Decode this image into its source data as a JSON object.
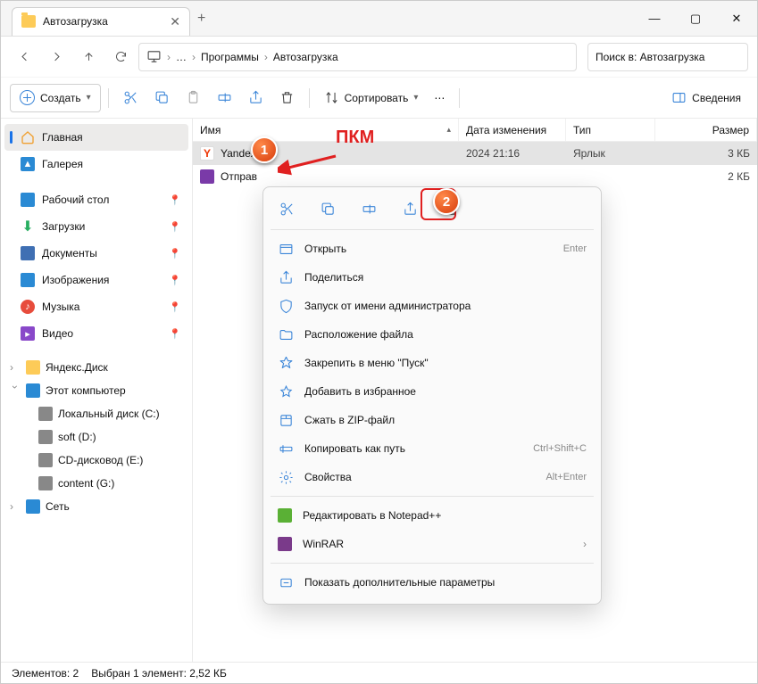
{
  "window": {
    "tab_title": "Автозагрузка"
  },
  "nav": {
    "crumbs": {
      "root_icon": "monitor",
      "ellipsis": "…",
      "item1": "Программы",
      "item2": "Автозагрузка"
    },
    "search_placeholder": "Поиск в: Автозагрузка"
  },
  "toolbar": {
    "create": "Создать",
    "sort": "Сортировать",
    "details": "Сведения"
  },
  "sidebar": {
    "home": "Главная",
    "gallery": "Галерея",
    "desktop": "Рабочий стол",
    "downloads": "Загрузки",
    "documents": "Документы",
    "pictures": "Изображения",
    "music": "Музыка",
    "video": "Видео",
    "yadisk": "Яндекс.Диск",
    "thispc": "Этот компьютер",
    "drive_c": "Локальный диск (C:)",
    "drive_d": "soft (D:)",
    "drive_e": "CD-дисковод (E:)",
    "drive_g": "content (G:)",
    "network": "Сеть"
  },
  "columns": {
    "name": "Имя",
    "date": "Дата изменения",
    "type": "Тип",
    "size": "Размер"
  },
  "files": [
    {
      "name": "Yandex",
      "date": "2024 21:16",
      "type": "Ярлык",
      "size": "3 КБ"
    },
    {
      "name": "Отправ",
      "date": "",
      "type": "",
      "size": "2 КБ"
    }
  ],
  "context": {
    "open": "Открыть",
    "open_sc": "Enter",
    "share": "Поделиться",
    "runas": "Запуск от имени администратора",
    "location": "Расположение файла",
    "pin_start": "Закрепить в меню \"Пуск\"",
    "favorite": "Добавить в избранное",
    "zip": "Сжать в ZIP-файл",
    "copy_path": "Копировать как путь",
    "copy_path_sc": "Ctrl+Shift+C",
    "properties": "Свойства",
    "properties_sc": "Alt+Enter",
    "notepadpp": "Редактировать в Notepad++",
    "winrar": "WinRAR",
    "more": "Показать дополнительные параметры"
  },
  "status": {
    "count": "Элементов: 2",
    "selected": "Выбран 1 элемент: 2,52 КБ"
  },
  "annotations": {
    "pkm": "ПКМ",
    "b1": "1",
    "b2": "2"
  }
}
